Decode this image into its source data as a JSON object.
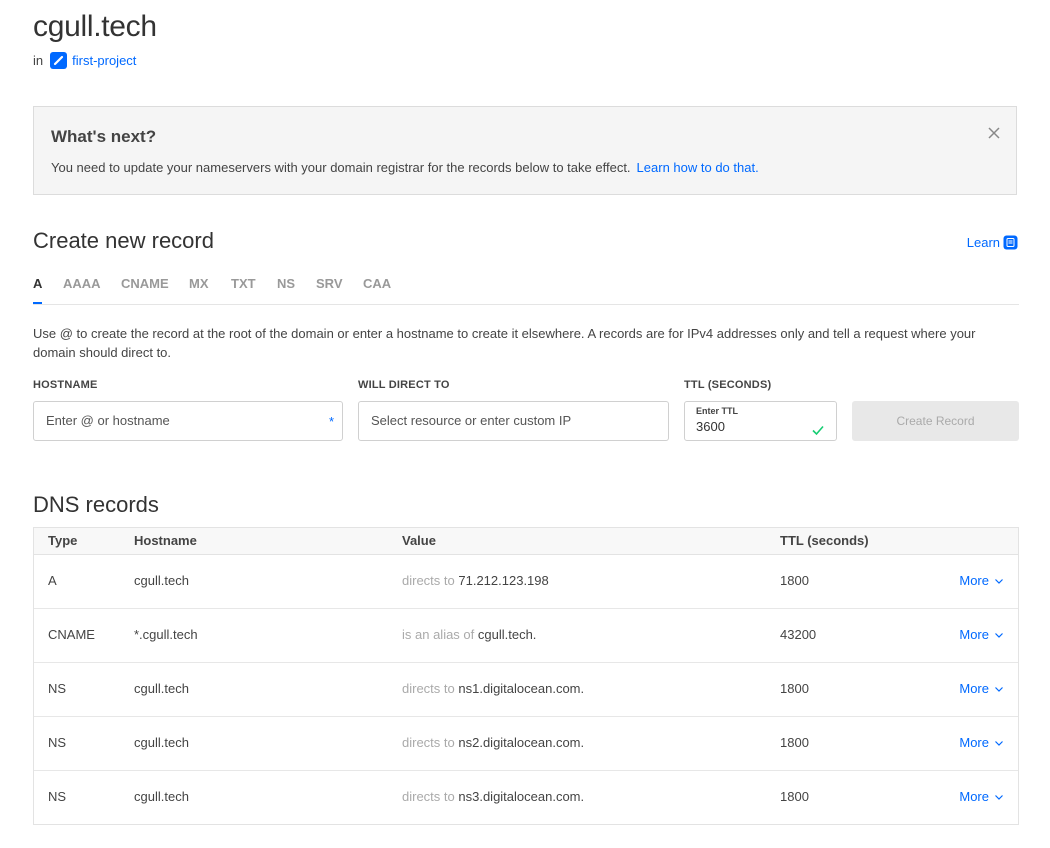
{
  "header": {
    "title": "cgull.tech",
    "in_label": "in",
    "project": "first-project"
  },
  "banner": {
    "title": "What's next?",
    "text": "You need to update your nameservers with your domain registrar for the records below to take effect.",
    "link": "Learn how to do that."
  },
  "create": {
    "title": "Create new record",
    "learn": "Learn",
    "tabs": [
      "A",
      "AAAA",
      "CNAME",
      "MX",
      "TXT",
      "NS",
      "SRV",
      "CAA"
    ],
    "active_tab": "A",
    "description": "Use @ to create the record at the root of the domain or enter a hostname to create it elsewhere. A records are for IPv4 addresses only and tell a request where your domain should direct to.",
    "hostname_label": "HOSTNAME",
    "hostname_placeholder": "Enter @ or hostname",
    "required_mark": "*",
    "direct_label": "WILL DIRECT TO",
    "direct_placeholder": "Select resource or enter custom IP",
    "ttl_label": "TTL (SECONDS)",
    "ttl_small": "Enter TTL",
    "ttl_value": "3600",
    "button": "Create Record"
  },
  "dns": {
    "title": "DNS records",
    "headers": [
      "Type",
      "Hostname",
      "Value",
      "TTL (seconds)"
    ],
    "more_label": "More",
    "rows": [
      {
        "type": "A",
        "hostname": "cgull.tech",
        "prefix": "directs to",
        "value": "71.212.123.198",
        "ttl": "1800"
      },
      {
        "type": "CNAME",
        "hostname": "*.cgull.tech",
        "prefix": "is an alias of",
        "value": "cgull.tech.",
        "ttl": "43200"
      },
      {
        "type": "NS",
        "hostname": "cgull.tech",
        "prefix": "directs to",
        "value": "ns1.digitalocean.com.",
        "ttl": "1800"
      },
      {
        "type": "NS",
        "hostname": "cgull.tech",
        "prefix": "directs to",
        "value": "ns2.digitalocean.com.",
        "ttl": "1800"
      },
      {
        "type": "NS",
        "hostname": "cgull.tech",
        "prefix": "directs to",
        "value": "ns3.digitalocean.com.",
        "ttl": "1800"
      }
    ]
  },
  "colors": {
    "accent": "#0069ff",
    "muted_text": "#aaaaaa",
    "banner_bg": "#f5f5f5",
    "button_disabled_bg": "#e8e8e8"
  },
  "icons": [
    "project-icon",
    "close-icon",
    "learn-doc-icon",
    "check-icon",
    "chevron-down-icon"
  ]
}
